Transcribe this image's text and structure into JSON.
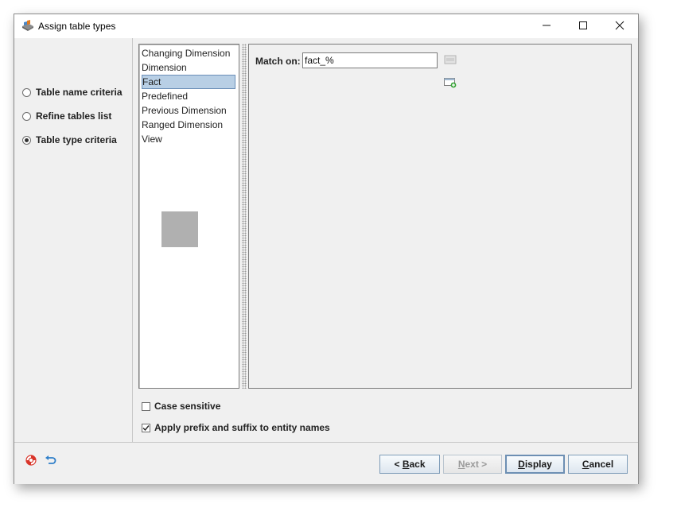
{
  "window": {
    "title": "Assign table types",
    "controls": {
      "minimize": "—",
      "maximize": "☐",
      "close": "✕"
    }
  },
  "left_options": [
    {
      "label": "Table name criteria",
      "selected": false
    },
    {
      "label": "Refine tables list",
      "selected": false
    },
    {
      "label": "Table type criteria",
      "selected": true
    }
  ],
  "table_types": {
    "items": [
      "Changing Dimension",
      "Dimension",
      "Fact",
      "Predefined",
      "Previous Dimension",
      "Ranged Dimension",
      "View"
    ],
    "selected": "Fact"
  },
  "match": {
    "label": "Match on:",
    "value": "fact_%"
  },
  "options": {
    "case_sensitive": {
      "label": "Case sensitive",
      "checked": false
    },
    "apply_prefix": {
      "label": "Apply prefix and suffix to entity names",
      "checked": true
    }
  },
  "footer": {
    "back": {
      "prefix": "< ",
      "mnemonic": "B",
      "rest": "ack"
    },
    "next": {
      "mnemonic": "N",
      "rest": "ext >"
    },
    "display": {
      "mnemonic": "D",
      "rest": "isplay"
    },
    "cancel": {
      "mnemonic": "C",
      "rest": "ancel"
    }
  },
  "icons": {
    "app": "app-logo-icon",
    "clear": "clear-field-icon",
    "add": "add-row-icon",
    "help": "help-lifebuoy-icon",
    "undo": "undo-icon"
  },
  "colors": {
    "selection_bg": "#b8cfe5",
    "selection_border": "#6b8fb8",
    "button_border": "#7f9db9",
    "help_icon": "#d9352a",
    "undo_icon": "#2f7fc9"
  }
}
